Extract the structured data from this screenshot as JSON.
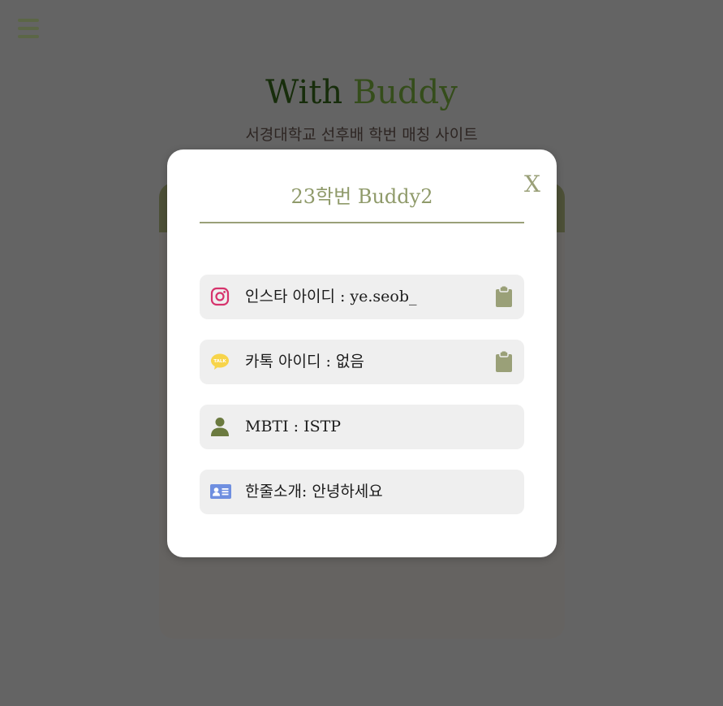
{
  "page": {
    "title_part1": "With ",
    "title_part2": "Buddy",
    "subtitle": "서경대학교 선후배 학번 매칭 사이트",
    "menu_icon": "hamburger-menu-icon"
  },
  "modal": {
    "title": "23학번 Buddy2",
    "close_label": "X",
    "rows": [
      {
        "icon": "instagram-icon",
        "text": "인스타 아이디 : ye.seob_",
        "copy_icon": "clipboard-icon"
      },
      {
        "icon": "kakaotalk-icon",
        "text": "카톡 아이디 : 없음",
        "copy_icon": "clipboard-icon"
      },
      {
        "icon": "person-icon",
        "text": "MBTI : ISTP"
      },
      {
        "icon": "id-card-icon",
        "text": "한줄소개: 안녕하세요"
      }
    ]
  },
  "colors": {
    "accent_green": "#9aa078",
    "title_dark_green": "#2e5a16",
    "title_light_green": "#6a9a36",
    "menu_green": "#b7cc8c",
    "instagram": "#d6336c",
    "kakao_yellow": "#f7d44a",
    "person_green": "#6b7a3f",
    "id_card_blue": "#6f8fe0",
    "clipboard": "#9aa078"
  }
}
